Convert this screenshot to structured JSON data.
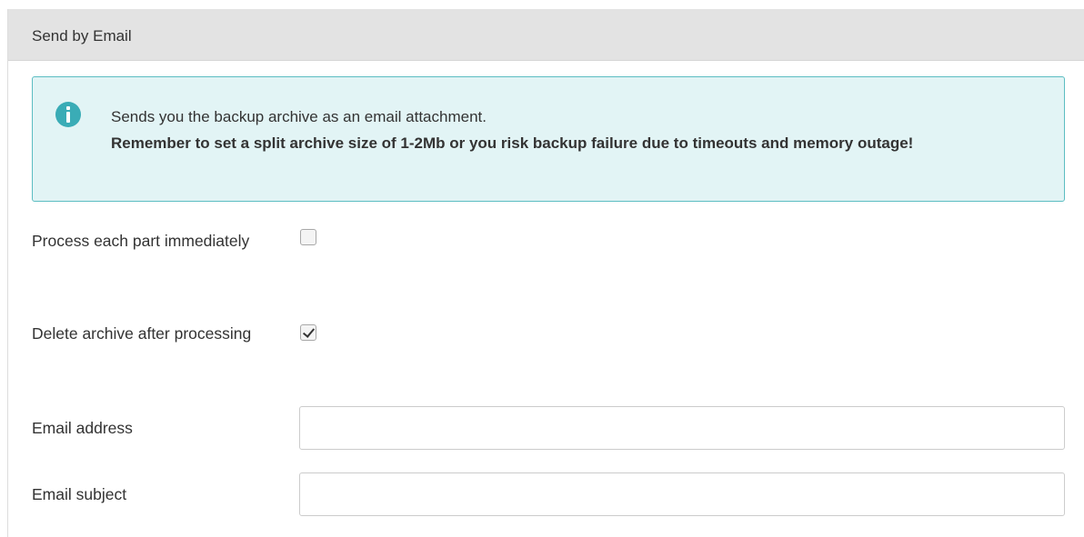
{
  "panel": {
    "title": "Send by Email"
  },
  "info_alert": {
    "icon": "info-icon",
    "text": "Sends you the backup archive as an email attachment.",
    "warning": "Remember to set a split archive size of 1-2Mb or you risk backup failure due to timeouts and memory outage!"
  },
  "fields": {
    "process_each_part": {
      "label": "Process each part immediately",
      "checked": false
    },
    "delete_archive": {
      "label": "Delete archive after processing",
      "checked": true
    },
    "email_address": {
      "label": "Email address",
      "value": ""
    },
    "email_subject": {
      "label": "Email subject",
      "value": ""
    }
  },
  "colors": {
    "header_bg": "#e3e3e3",
    "alert_bg": "#e2f4f5",
    "alert_border": "#5cbdc2",
    "info_icon": "#3aacb6"
  }
}
